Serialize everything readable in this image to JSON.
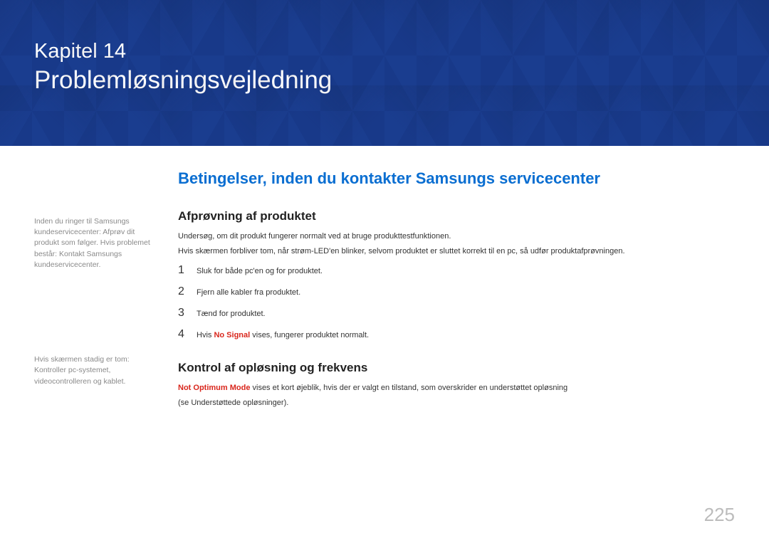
{
  "header": {
    "chapter_label": "Kapitel  14",
    "chapter_title": "Problemløsningsvejledning"
  },
  "section_heading": "Betingelser, inden du kontakter Samsungs servicecenter",
  "side": {
    "note1": "Inden du ringer til Samsungs kundeservicecenter: Afprøv dit produkt som følger. Hvis problemet består: Kontakt Samsungs kundeservicecenter.",
    "note2": "Hvis skærmen stadig er tom: Kontroller pc-systemet, videocontrolleren og kablet."
  },
  "main": {
    "h1": "Afprøvning af produktet",
    "p1": "Undersøg, om dit produkt fungerer normalt ved at bruge produkttestfunktionen.",
    "p2": "Hvis skærmen forbliver tom, når strøm-LED'en blinker, selvom produktet er sluttet korrekt til en pc, så udfør produktafprøvningen.",
    "steps": [
      "Sluk for både pc'en og for produktet.",
      "Fjern alle kabler fra produktet.",
      "Tænd for produktet."
    ],
    "step4_prefix": "Hvis ",
    "step4_red": "No Signal",
    "step4_suffix": " vises, fungerer produktet normalt.",
    "h2": "Kontrol af opløsning og frekvens",
    "p3_red": "Not Optimum Mode",
    "p3_rest": " vises et kort øjeblik, hvis der er valgt en tilstand, som overskrider en understøttet opløsning",
    "p4": "(se Understøttede opløsninger)."
  },
  "page_number": "225"
}
